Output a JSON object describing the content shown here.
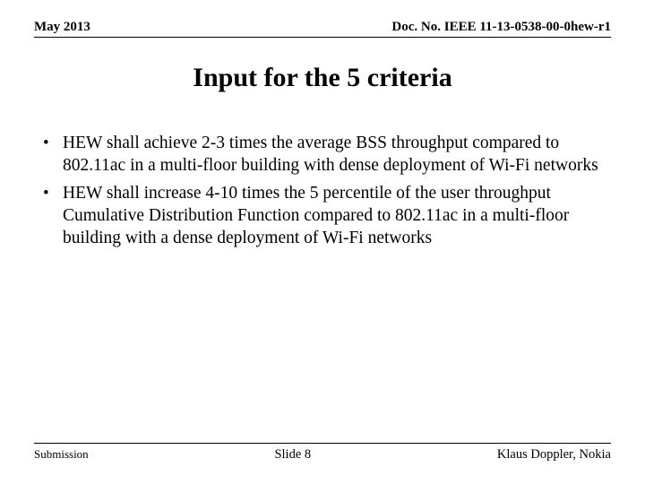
{
  "header": {
    "date": "May 2013",
    "doc_no": "Doc. No. IEEE 11-13-0538-00-0hew-r1"
  },
  "title": "Input for the 5 criteria",
  "bullets": [
    "HEW shall achieve 2-3 times the average BSS throughput compared to 802.11ac in a multi-floor building with dense deployment of Wi-Fi networks",
    "HEW shall increase 4-10 times the 5 percentile of the user throughput Cumulative Distribution Function compared to 802.11ac in a multi-floor building with a dense deployment of Wi-Fi networks"
  ],
  "footer": {
    "left": "Submission",
    "center": "Slide 8",
    "right": "Klaus Doppler, Nokia"
  }
}
